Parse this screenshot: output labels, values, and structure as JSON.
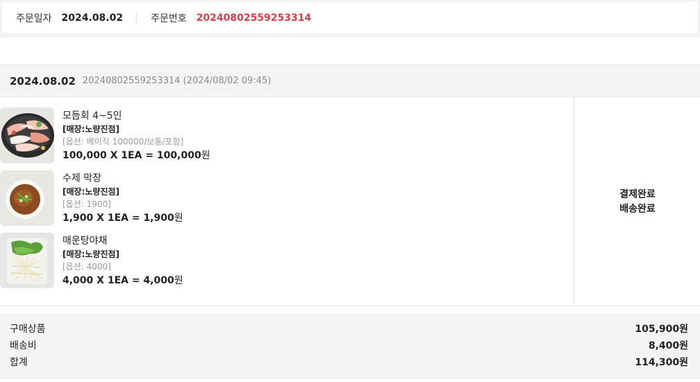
{
  "order_info": {
    "date_label": "주문일자",
    "date_value": "2024.08.02",
    "number_label": "주문번호",
    "number_value": "20240802559253314"
  },
  "order_header": {
    "date": "2024.08.02",
    "meta": "20240802559253314 (2024/08/02 09:45)"
  },
  "items": [
    {
      "name": "모듬회 4~5인",
      "store": "[매장:노량진점]",
      "option": "[옵션: 베이직 100000/보통/포함]",
      "price_expr": "100,000 X 1EA = 100,000",
      "currency": "원",
      "image_icon": "sashimi-platter-image"
    },
    {
      "name": "수제 막장",
      "store": "[매장:노량진점]",
      "option": "[옵션: 1900]",
      "price_expr": "1,900 X 1EA = 1,900",
      "currency": "원",
      "image_icon": "sauce-bowl-image"
    },
    {
      "name": "매운탕야채",
      "store": "[매장:노량진점]",
      "option": "[옵션: 4000]",
      "price_expr": "4,000 X 1EA = 4,000",
      "currency": "원",
      "image_icon": "vegetable-pack-image"
    }
  ],
  "status": {
    "payment": "결제완료",
    "delivery": "배송완료"
  },
  "summary": {
    "products_label": "구매상품",
    "products_value": "105,900원",
    "shipping_label": "배송비",
    "shipping_value": "8,400원",
    "total_label": "합계",
    "total_value": "114,300원"
  },
  "colors": {
    "accent_red": "#d9404a",
    "muted_text": "#8a8a8a",
    "panel_bg": "#f4f4f4"
  }
}
